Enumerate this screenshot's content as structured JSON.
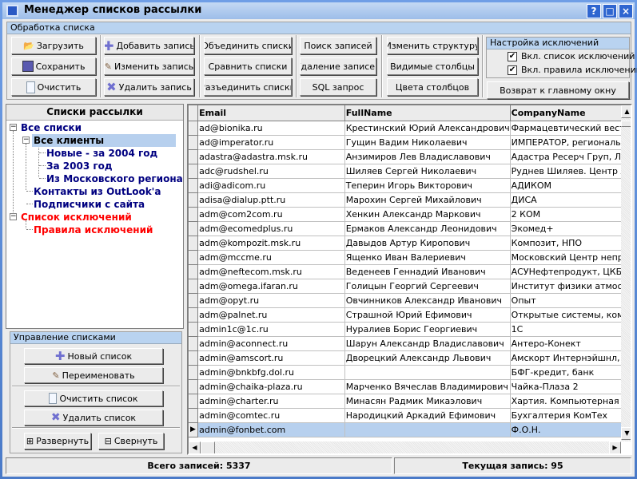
{
  "window": {
    "title": "Менеджер списков рассылки",
    "help": "?",
    "maximize": "□",
    "close": "×"
  },
  "processing": {
    "title": "Обработка списка",
    "load": "Загрузить",
    "save": "Сохранить",
    "clear": "Очистить",
    "add_record": "Добавить запись",
    "edit_record": "Изменить запись",
    "delete_record": "Удалить запись",
    "merge": "Объединить списки",
    "compare": "Сравнить списки",
    "split": "Разъединить списки",
    "search": "Поиск записей",
    "delete_records": "Удаление записей",
    "sql": "SQL запрос",
    "change_structure": "Изменить структуру",
    "visible_columns": "Видимые столбцы",
    "column_colors": "Цвета столбцов"
  },
  "exclusions": {
    "title": "Настройка исключений",
    "list_label": "Вкл. список исключений",
    "list_checked": true,
    "rules_label": "Вкл. правила исключений",
    "rules_checked": true,
    "back": "Возврат к главному окну"
  },
  "tree": {
    "title": "Списки рассылки",
    "nodes": [
      "Все списки",
      "Все клиенты",
      "Новые - за 2004 год",
      "За 2003 год",
      "Из Московского региона",
      "Контакты из OutLook'a",
      "Подписчики с сайта",
      "Список исключений",
      "Правила исключений"
    ]
  },
  "manage": {
    "title": "Управление списками",
    "new": "Новый список",
    "rename": "Переименовать",
    "clear": "Очистить список",
    "delete": "Удалить список",
    "expand": "Развернуть",
    "collapse": "Свернуть"
  },
  "grid": {
    "columns": [
      "Email",
      "FullName",
      "CompanyName"
    ],
    "current_row": 21,
    "rows": [
      [
        "ad@bionika.ru",
        "Крестинский Юрий Александрович",
        "Фармацевтический вест"
      ],
      [
        "ad@imperator.ru",
        "Гущин Вадим Николаевич",
        "ИМПЕРАТОР, региональ"
      ],
      [
        "adastra@adastra.msk.ru",
        "Анзимиров Лев Владиславович",
        "Адастра Ресерч Груп, ЛТ"
      ],
      [
        "adc@rudshel.ru",
        "Шиляев Сергей Николаевич",
        "Руднев Шиляев. Центр А"
      ],
      [
        "adi@adicom.ru",
        "Теперин Игорь Викторович",
        "АДИКОМ"
      ],
      [
        "adisa@dialup.ptt.ru",
        "Марохин Сергей Михайлович",
        "ДИСА"
      ],
      [
        "adm@com2com.ru",
        "Хенкин Александр Маркович",
        "2 КОМ"
      ],
      [
        "adm@ecomedplus.ru",
        "Ермаков Александр Леонидович",
        "Экомед+"
      ],
      [
        "adm@kompozit.msk.ru",
        "Давыдов Артур Киропович",
        "Композит, НПО"
      ],
      [
        "adm@mccme.ru",
        "Ященко Иван Валериевич",
        "Московский Центр непр"
      ],
      [
        "adm@neftecom.msk.ru",
        "Веденеев Геннадий Иванович",
        "АСУНефтепродукт, ЦКБ"
      ],
      [
        "adm@omega.ifaran.ru",
        "Голицын Георгий Сергеевич",
        "Институт физики атмосф"
      ],
      [
        "adm@opyt.ru",
        "Овчинников Александр Иванович",
        "Опыт"
      ],
      [
        "adm@palnet.ru",
        "Страшной Юрий Ефимович",
        "Открытые системы, ком"
      ],
      [
        "admin1c@1c.ru",
        "Нуралиев Борис Георгиевич",
        "1С"
      ],
      [
        "admin@aconnect.ru",
        "Шарун Александр Владиславович",
        "Антеро-Конект"
      ],
      [
        "admin@amscort.ru",
        "Дворецкий Александр Львович",
        "Амскорт Интернэйшнл, О"
      ],
      [
        "admin@bnkbfg.dol.ru",
        "",
        "БФГ-кредит, банк"
      ],
      [
        "admin@chaika-plaza.ru",
        "Марченко Вячеслав Владимирович",
        "Чайка-Плаза 2"
      ],
      [
        "admin@charter.ru",
        "Минасян Радмик Микаэлович",
        "Хартия. Компьютерная т"
      ],
      [
        "admin@comtec.ru",
        "Народицкий Аркадий Ефимович",
        "Бухгалтерия КомТех"
      ],
      [
        "admin@fonbet.com",
        "",
        "Ф.О.Н."
      ]
    ]
  },
  "status": {
    "total": "Всего записей: 5337",
    "current": "Текущая запись: 95"
  }
}
